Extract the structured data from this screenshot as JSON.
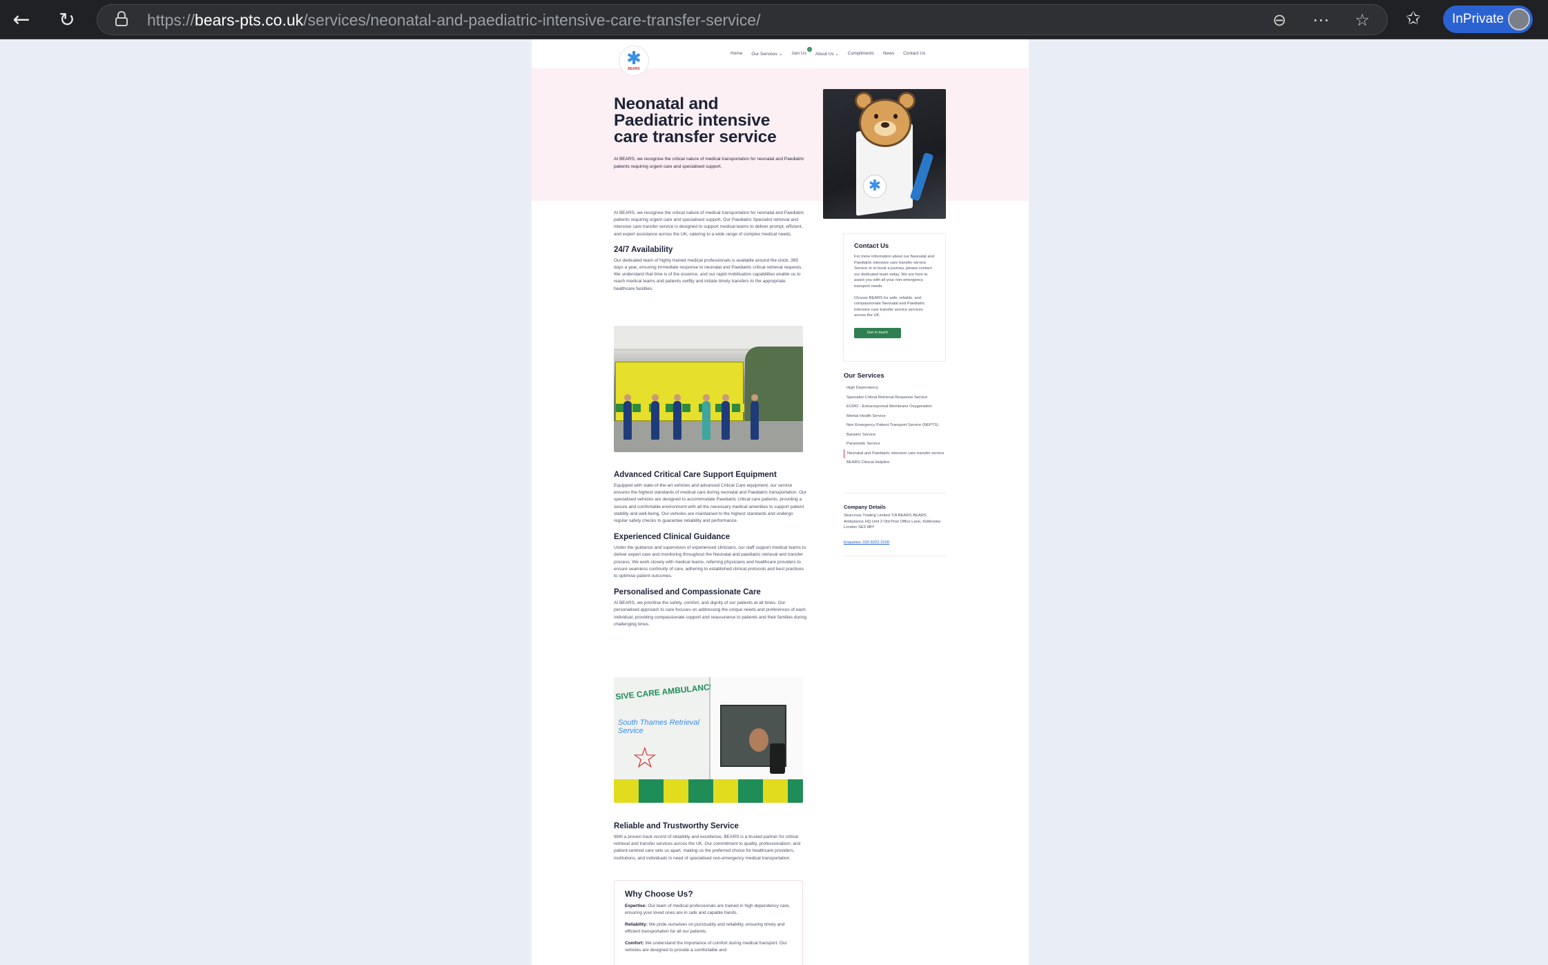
{
  "browser": {
    "url_prefix": "https://",
    "url_host": "bears-pts.co.uk",
    "url_path": "/services/neonatal-and-paediatric-intensive-care-transfer-service/",
    "inprivate_label": "InPrivate"
  },
  "site": {
    "logo_text": "BEARS",
    "nav": [
      "Home",
      "Our Services",
      "Join Us",
      "About Us",
      "Compliments",
      "News",
      "Contact Us"
    ],
    "join_badge": "0"
  },
  "hero": {
    "title": "Neonatal and Paediatric intensive care transfer service",
    "subtitle": "At BEARS, we recognise the critical nature of medical transportation for neonatal and Paediatric patients requiring urgent care and specialised support."
  },
  "content": {
    "intro": "At BEARS, we recognise the critical nature of medical transportation for neonatal and Paediatric patients requiring urgent care and specialised support. Our Paediatric Specialist retrieval and intensive care transfer service is designed to support medical teams to deliver prompt, efficient, and expert assistance across the UK, catering to a wide range of complex medical needs.",
    "s1_title": "24/7 Availability",
    "s1_body": "Our dedicated team of highly trained medical professionals is available around the clock, 365 days a year, ensuring immediate response to neonatal and Paediatric critical retrieval requests. We understand that time is of the essence, and our rapid mobilisation capabilities enable us to reach medical teams and patients swiftly and initiate timely transfers to the appropriate healthcare facilities.",
    "s2_title": "Advanced Critical Care Support Equipment",
    "s2_body": "Equipped with state-of-the-art vehicles and advanced Critical Care equipment, our service ensures the highest standards of medical care during neonatal and Paediatric transportation. Our specialised vehicles are designed to accommodate Paediatric critical care patients, providing a secure and comfortable environment with all the necessary medical amenities to support patient stability and well-being. Our vehicles are maintained to the highest standards and undergo regular safety checks to guarantee reliability and performance.",
    "s3_title": "Experienced Clinical Guidance",
    "s3_body": "Under the guidance and supervision of experienced clinicians, our staff support medical teams to deliver expert care and monitoring throughout the Neonatal and paediatric retrieval and transfer process. We work closely with medical teams, referring physicians and healthcare providers to ensure seamless continuity of care, adhering to established clinical protocols and best practices to optimise patient outcomes.",
    "s4_title": "Personalised and Compassionate Care",
    "s4_body": "At BEARS, we prioritise the safety, comfort, and dignity of our patients at all times. Our personalised approach to care focuses on addressing the unique needs and preferences of each individual, providing compassionate support and reassurance to patients and their families during challenging times.",
    "s5_title": "Reliable and Trustworthy Service",
    "s5_body": "With a proven track record of reliability and excellence, BEARS is a trusted partner for critical retrieval and transfer services across the UK. Our commitment to quality, professionalism, and patient-centred care sets us apart, making us the preferred choice for healthcare providers, institutions, and individuals in need of specialised non-emergency medical transportation.",
    "photo2_van_text": "SIVE CARE AMBULANCE",
    "photo2_logo_text": "South Thames Retrieval Service"
  },
  "why": {
    "title": "Why Choose Us?",
    "items": [
      {
        "label": "Expertise:",
        "text": "Our team of medical professionals are trained in high dependency care, ensuring your loved ones are in safe and capable hands."
      },
      {
        "label": "Reliability:",
        "text": "We pride ourselves on punctuality and reliability, ensuring timely and efficient transportation for all our patients."
      },
      {
        "label": "Comfort:",
        "text": "We understand the importance of comfort during medical transport. Our vehicles are designed to provide a comfortable and"
      }
    ]
  },
  "sidebar": {
    "contact_title": "Contact Us",
    "contact_p1": "For more information about our Neonatal and Paediatric intensive care transfer service Service or to book a journey, please contact our dedicated team today. We are here to assist you with all your non-emergency transport needs.",
    "contact_p2": "Choose BEARS for safe, reliable, and compassionate Neonatal and Paediatric intensive care transfer service services across the UK.",
    "contact_button": "Get in touch",
    "services_title": "Our Services",
    "services": [
      "High Dependency",
      "Specialist Critical Retrieval Response Service",
      "ECMO - Extracorporeal Membrane Oxygenation",
      "Mental Health Service",
      "Non Emergency Patient Transport Service (NEPTS)",
      "Bariatric Service",
      "Paramedic Service",
      "Neonatal and Paediatric intensive care transfer service",
      "BEARS Clinical Helpline"
    ],
    "company_title": "Company Details",
    "company_text": "Skarcross Trading Limited T/A BEARS BEARS Ambulance HQ Unit 2 Old Post Office Lane, Kidbrooke London SE3 9BY",
    "company_link": "Enquiries: 020 8202 3100"
  }
}
